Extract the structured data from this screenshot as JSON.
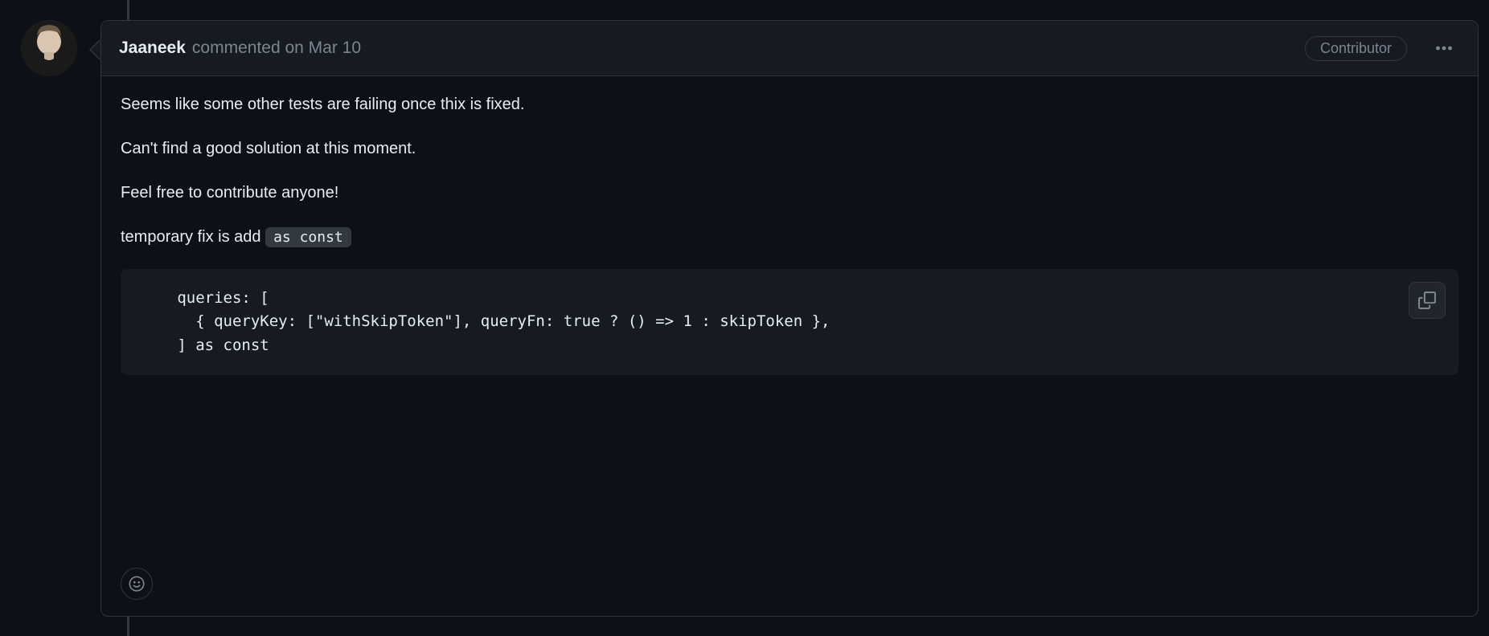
{
  "comment": {
    "author": "Jaaneek",
    "action": "commented ",
    "timestamp": "on Mar 10",
    "badge": "Contributor",
    "body": {
      "p1": "Seems like some other tests are failing once thix is fixed.",
      "p2": "Can't find a good solution at this moment.",
      "p3": "Feel free to contribute anyone!",
      "p4_prefix": "temporary fix is add ",
      "p4_code": "as const"
    },
    "code": "   queries: [\n     { queryKey: [\"withSkipToken\"], queryFn: true ? () => 1 : skipToken },\n   ] as const"
  }
}
